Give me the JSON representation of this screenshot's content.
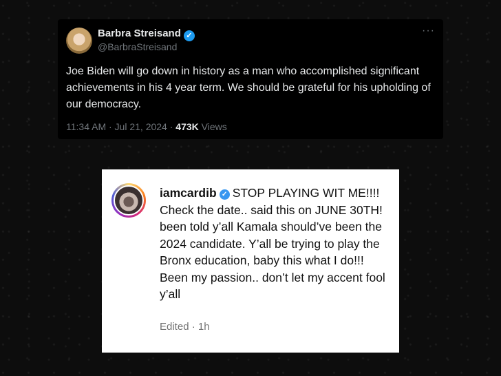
{
  "tweet": {
    "author_name": "Barbra Streisand",
    "handle": "@BarbraStreisand",
    "more_icon": "···",
    "text": "Joe Biden will go down in history as a man who accomplished significant achievements in his 4 year term. We should be grateful for his upholding of our democracy.",
    "timestamp": "11:34 AM · Jul 21, 2024 · ",
    "views_count": "473K",
    "views_label": " Views"
  },
  "instagram": {
    "username": "iamcardib",
    "comment": "STOP PLAYING WIT ME!!!! Check the date.. said this on JUNE 30TH! been told y’all Kamala should’ve been the 2024 candidate. Y’all be trying to play the Bronx education, baby this what I do!!! Been my passion.. don’t let my accent fool y’all",
    "meta": "Edited · 1h"
  },
  "colors": {
    "twitter_verified": "#1d9bf0",
    "instagram_verified": "#3897f0"
  },
  "icons": {
    "verified": "checkmark-badge-icon",
    "more": "more-options-icon"
  }
}
